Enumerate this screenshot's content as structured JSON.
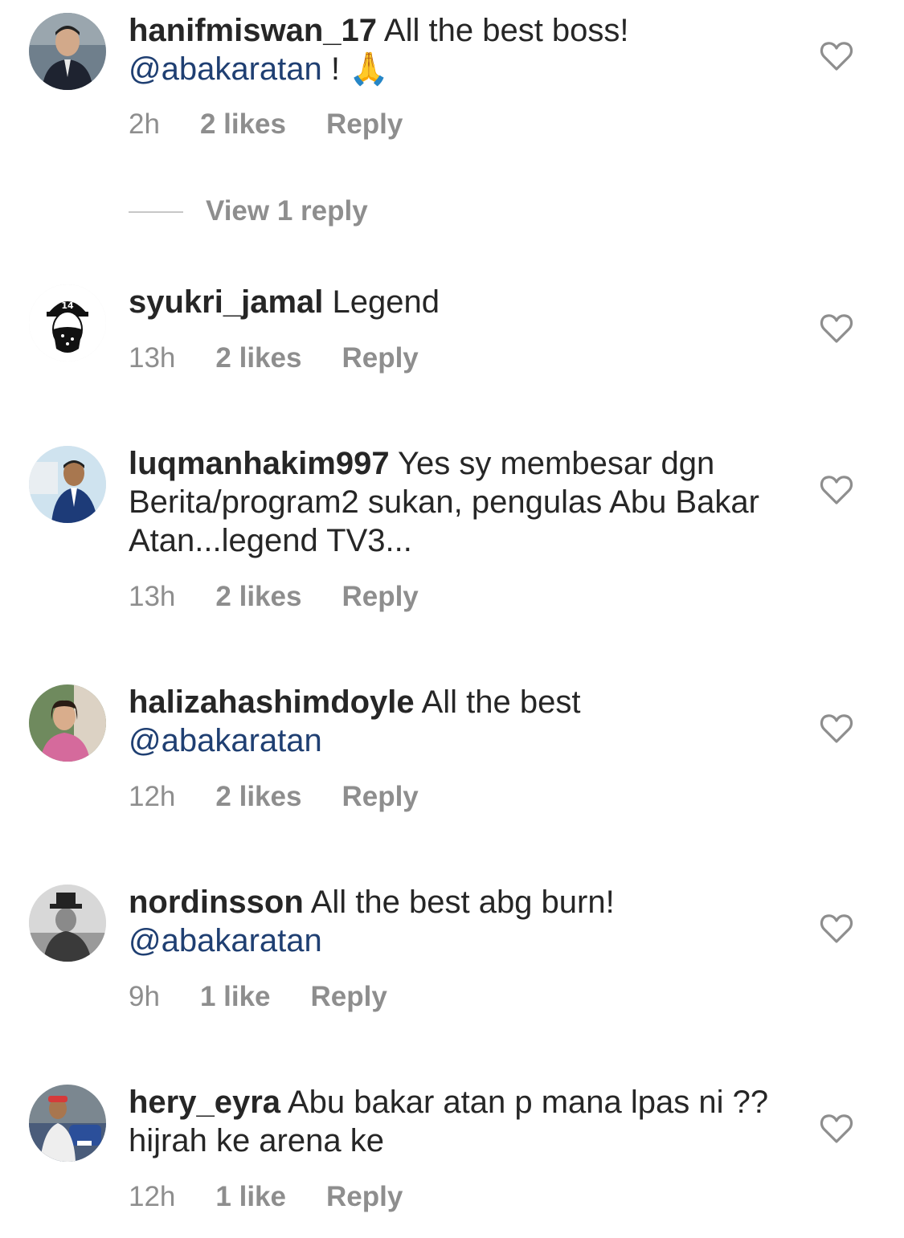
{
  "comments": [
    {
      "username": "hanifmiswan_17",
      "text": "All the best boss!",
      "mention": "@abakaratan",
      "suffix": " !",
      "emoji": "🙏",
      "time": "2h",
      "likes": "2 likes",
      "reply": "Reply",
      "avatar_icon": "man-in-suit-avatar"
    },
    {
      "username": "syukri_jamal",
      "text": "Legend",
      "time": "13h",
      "likes": "2 likes",
      "reply": "Reply",
      "avatar_icon": "bandana-cap-avatar"
    },
    {
      "username": "luqmanhakim997",
      "text": "Yes sy membesar dgn Berita/program2 sukan, pengulas Abu Bakar Atan...legend TV3...",
      "time": "13h",
      "likes": "2 likes",
      "reply": "Reply",
      "avatar_icon": "man-at-seminar-avatar"
    },
    {
      "username": "halizahashimdoyle",
      "text": "All the best",
      "mention": "@abakaratan",
      "time": "12h",
      "likes": "2 likes",
      "reply": "Reply",
      "avatar_icon": "woman-portrait-avatar"
    },
    {
      "username": "nordinsson",
      "text": "All the best abg burn!",
      "mention": "@abakaratan",
      "time": "9h",
      "likes": "1 like",
      "reply": "Reply",
      "avatar_icon": "man-in-hat-bw-avatar"
    },
    {
      "username": "hery_eyra",
      "text": "Abu bakar atan p mana lpas ni ??hijrah ke arena ke",
      "time": "12h",
      "likes": "1 like",
      "reply": "Reply",
      "avatar_icon": "man-with-car-avatar"
    }
  ],
  "view_replies": "View 1 reply",
  "colors": {
    "text": "#262626",
    "meta": "#8e8e8e",
    "mention": "#1f3f72",
    "divider": "#c7c7c7"
  }
}
